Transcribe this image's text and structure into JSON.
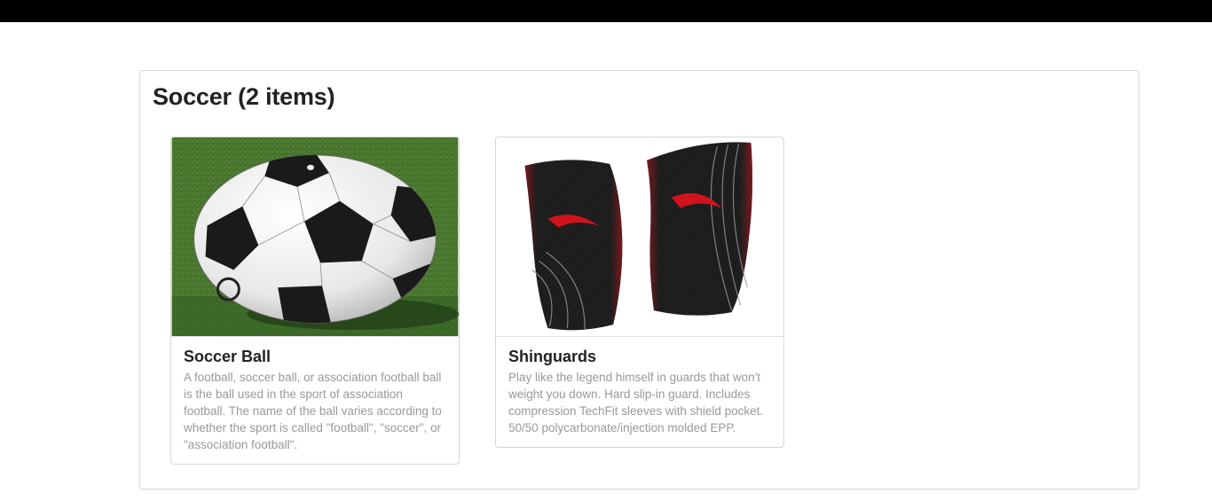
{
  "category": {
    "title": "Soccer (2 items)"
  },
  "products": [
    {
      "name": "Soccer Ball",
      "description": "A football, soccer ball, or association football ball is the ball used in the sport of association football. The name of the ball varies according to whether the sport is called \"football\", \"soccer\", or \"association football\".",
      "image": "soccer-ball-on-grass"
    },
    {
      "name": "Shinguards",
      "description": "Play like the legend himself in guards that won't weight you down. Hard slip-in guard. Includes compression TechFit sleeves with shield pocket. 50/50 polycarbonate/injection molded EPP.",
      "image": "black-red-shinguards"
    }
  ],
  "colors": {
    "topbar": "#000000",
    "title": "#222222",
    "description": "#999999",
    "border": "#d6d6d6",
    "accent_red": "#d0131c"
  }
}
